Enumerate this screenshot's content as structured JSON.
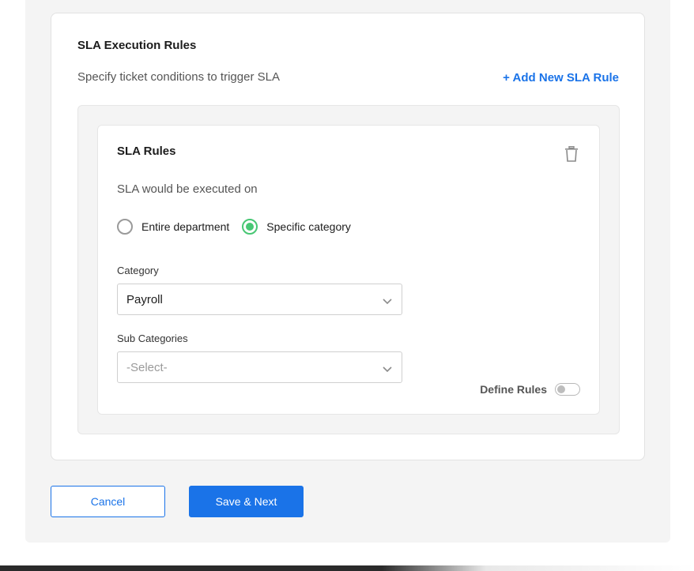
{
  "execution_rules": {
    "title": "SLA Execution Rules",
    "subtitle": "Specify ticket conditions to trigger SLA",
    "add_rule_label": "+ Add New SLA Rule"
  },
  "rule": {
    "title": "SLA Rules",
    "executed_on_label": "SLA would be executed on",
    "options": [
      {
        "label": "Entire department",
        "checked": false
      },
      {
        "label": "Specific category",
        "checked": true
      }
    ],
    "category": {
      "label": "Category",
      "value": "Payroll"
    },
    "sub_categories": {
      "label": "Sub Categories",
      "placeholder": "-Select-"
    },
    "define_rules": {
      "label": "Define Rules",
      "enabled": false
    }
  },
  "actions": {
    "cancel_label": "Cancel",
    "save_label": "Save & Next"
  },
  "colors": {
    "accent": "#1a73e8",
    "radio_checked": "#48c774"
  },
  "icons": [
    "trash-icon",
    "chevron-down-icon"
  ]
}
